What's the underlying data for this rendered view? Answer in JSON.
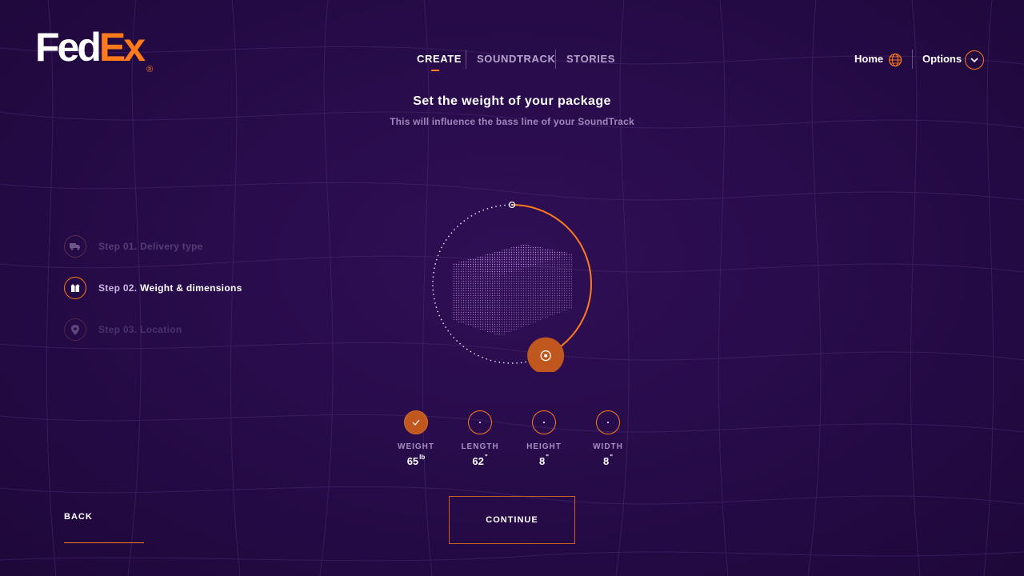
{
  "brand": {
    "logo_fed": "Fed",
    "logo_ex": "Ex",
    "logo_mark": "®"
  },
  "nav": {
    "tabs": [
      {
        "label": "CREATE",
        "active": true
      },
      {
        "label": "SOUNDTRACK",
        "active": false
      },
      {
        "label": "STORIES",
        "active": false
      }
    ],
    "home_label": "Home",
    "home_icon": "globe-icon",
    "options_label": "Options",
    "options_icon": "chevron-down-icon"
  },
  "main": {
    "title": "Set the weight of your package",
    "subtitle": "This will influence the bass line of your SoundTrack"
  },
  "steps": [
    {
      "number": "Step 01.",
      "label": "Delivery type",
      "icon": "truck-icon",
      "state": "done"
    },
    {
      "number": "Step 02.",
      "label": "Weight & dimensions",
      "icon": "box-icon",
      "state": "current"
    },
    {
      "number": "Step 03.",
      "label": "Location",
      "icon": "location-pin-icon",
      "state": "upcoming"
    }
  ],
  "dial": {
    "progress": 0.43,
    "handle_icon": "target-icon"
  },
  "metrics": [
    {
      "label": "WEIGHT",
      "value": "65",
      "unit": "lb",
      "state": "done",
      "icon": "check-icon"
    },
    {
      "label": "LENGTH",
      "value": "62",
      "unit": "\"",
      "state": "pending"
    },
    {
      "label": "HEIGHT",
      "value": "8",
      "unit": "\"",
      "state": "pending"
    },
    {
      "label": "WIDTH",
      "value": "8",
      "unit": "\"",
      "state": "pending"
    }
  ],
  "actions": {
    "back_label": "BACK",
    "continue_label": "CONTINUE"
  },
  "colors": {
    "accent": "#ff7a1a",
    "background": "#260b48",
    "muted_text": "#9f87bd"
  }
}
